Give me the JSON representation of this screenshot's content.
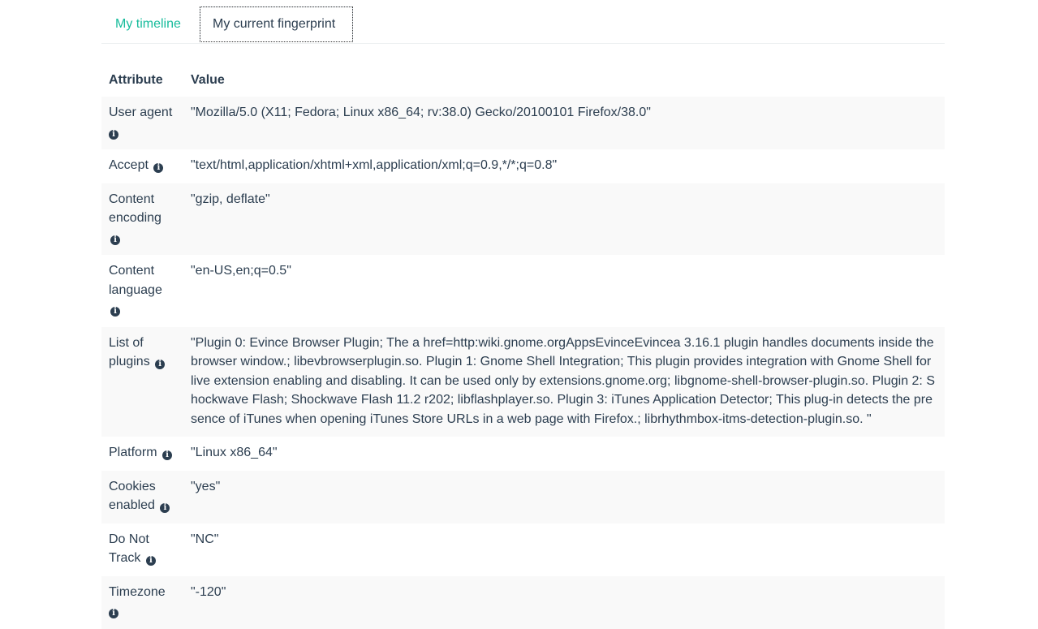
{
  "tabs": {
    "timeline": "My timeline",
    "fingerprint": "My current fingerprint"
  },
  "table": {
    "headers": [
      "Attribute",
      "Value"
    ],
    "rows": [
      {
        "attribute_line1": "User agent",
        "attribute_line2": "",
        "value": "\"Mozilla/5.0 (X11; Fedora; Linux x86_64; rv:38.0) Gecko/20100101 Firefox/38.0\""
      },
      {
        "attribute_line1": "Accept",
        "attribute_line2": "",
        "value": "\"text/html,application/xhtml+xml,application/xml;q=0.9,*/*;q=0.8\""
      },
      {
        "attribute_line1": "Content",
        "attribute_line2": "encoding",
        "value": "\"gzip, deflate\""
      },
      {
        "attribute_line1": "Content",
        "attribute_line2": "language",
        "value": "\"en-US,en;q=0.5\""
      },
      {
        "attribute_line1": "List of",
        "attribute_line2": "plugins",
        "value": "\"Plugin 0: Evince Browser Plugin; The a href=http:wiki.gnome.orgAppsEvinceEvincea 3.16.1 plugin handles documents inside the browser window.; libevbrowserplugin.so. Plugin 1: Gnome Shell Integration; This plugin provides integration with Gnome Shell for live extension enabling and disabling. It can be used only by extensions.gnome.org; libgnome-shell-browser-plugin.so. Plugin 2: Shockwave Flash; Shockwave Flash 11.2 r202; libflashplayer.so. Plugin 3: iTunes Application Detector; This plug-in detects the presence of iTunes when opening iTunes Store URLs in a web page with Firefox.; librhythmbox-itms-detection-plugin.so. \""
      },
      {
        "attribute_line1": "Platform",
        "attribute_line2": "",
        "value": "\"Linux x86_64\""
      },
      {
        "attribute_line1": "Cookies",
        "attribute_line2": "enabled",
        "value": "\"yes\""
      },
      {
        "attribute_line1": "Do Not",
        "attribute_line2": "Track",
        "value": "\"NC\""
      },
      {
        "attribute_line1": "Timezone",
        "attribute_line2": "",
        "value": "\"-120\""
      }
    ]
  },
  "icons": {
    "info": "info-circle-icon"
  },
  "colors": {
    "link": "#18bc9c",
    "text": "#2c3e50",
    "stripe": "#f9f9f9"
  }
}
